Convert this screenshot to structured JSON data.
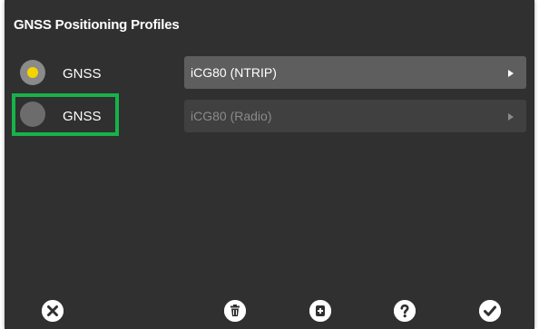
{
  "title": "GNSS Positioning Profiles",
  "profiles": [
    {
      "label": "GNSS",
      "selected": true,
      "device": "iCG80 (NTRIP)",
      "enabled": true
    },
    {
      "label": "GNSS",
      "selected": false,
      "device": "iCG80 (Radio)",
      "enabled": false
    }
  ],
  "toolbar": {
    "cancel": "close-icon",
    "delete": "trash-icon",
    "add": "add-icon",
    "help": "help-icon",
    "confirm": "check-icon"
  },
  "colors": {
    "panel_bg": "#303030",
    "radio_selected_dot": "#f4d400",
    "select_bg": "#5e5e5e",
    "select_disabled_bg": "#404040",
    "highlight": "#17b24a"
  }
}
